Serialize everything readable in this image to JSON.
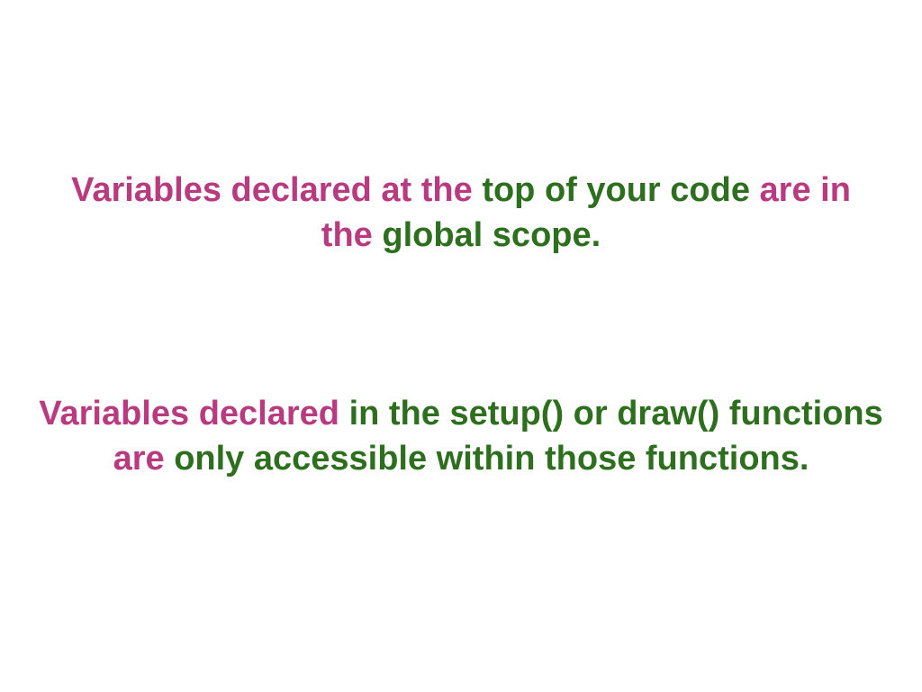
{
  "colors": {
    "pink": "#b93b7f",
    "green": "#2e6f1f",
    "background": "#ffffff"
  },
  "paragraph_1": {
    "segments": [
      {
        "text": "Variables declared at the ",
        "color": "pink"
      },
      {
        "text": "top of your code ",
        "color": "green"
      },
      {
        "text": "are in",
        "color": "pink"
      },
      {
        "text": " the ",
        "color": "pink"
      },
      {
        "text": "global scope.",
        "color": "green"
      }
    ]
  },
  "paragraph_2": {
    "segments": [
      {
        "text": "Variables declared ",
        "color": "pink"
      },
      {
        "text": "in the setup() or draw() functions ",
        "color": "green"
      },
      {
        "text": "are ",
        "color": "pink"
      },
      {
        "text": "only accessible within those functions.",
        "color": "green"
      }
    ]
  }
}
